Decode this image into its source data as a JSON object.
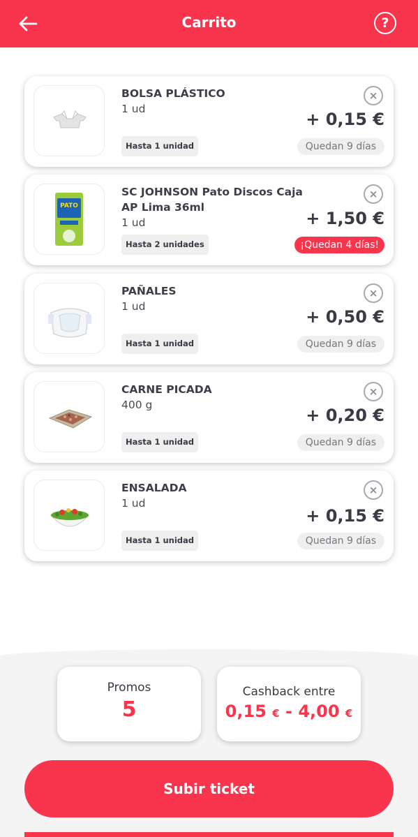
{
  "header": {
    "title": "Carrito",
    "back_icon": "arrow-left-icon",
    "help_icon": "question-circle-icon",
    "help_glyph": "?"
  },
  "remove_glyph": "×",
  "items": [
    {
      "name": "BOLSA PLÁSTICO",
      "qty": "1 ud",
      "limit": "Hasta 1 unidad",
      "price": "+ 0,15 €",
      "days": "Quedan 9 días",
      "urgent": false
    },
    {
      "name": "SC JOHNSON Pato Discos Caja AP Lima 36ml",
      "qty": "1 ud",
      "limit": "Hasta 2 unidades",
      "price": "+ 1,50 €",
      "days": "¡Quedan 4 días!",
      "urgent": true,
      "thumb_brand": "PATO"
    },
    {
      "name": "PAÑALES",
      "qty": "1 ud",
      "limit": "Hasta 1 unidad",
      "price": "+ 0,50 €",
      "days": "Quedan 9 días",
      "urgent": false
    },
    {
      "name": "CARNE PICADA",
      "qty": "400 g",
      "limit": "Hasta 1 unidad",
      "price": "+ 0,20 €",
      "days": "Quedan 9 días",
      "urgent": false
    },
    {
      "name": "ENSALADA",
      "qty": "1 ud",
      "limit": "Hasta 1 unidad",
      "price": "+ 0,15 €",
      "days": "Quedan 9 días",
      "urgent": false
    }
  ],
  "summary": {
    "promos_label": "Promos",
    "promos_value": "5",
    "cashback_label": "Cashback entre",
    "cashback_min": "0,15",
    "cashback_sep": "-",
    "cashback_max": "4,00",
    "currency": "€"
  },
  "upload_button": {
    "label": "Subir ticket"
  },
  "colors": {
    "accent": "#f8354d",
    "text": "#3a3a44",
    "chip_bg": "#efefef",
    "page_bottom_bg": "#f4f4f4"
  }
}
